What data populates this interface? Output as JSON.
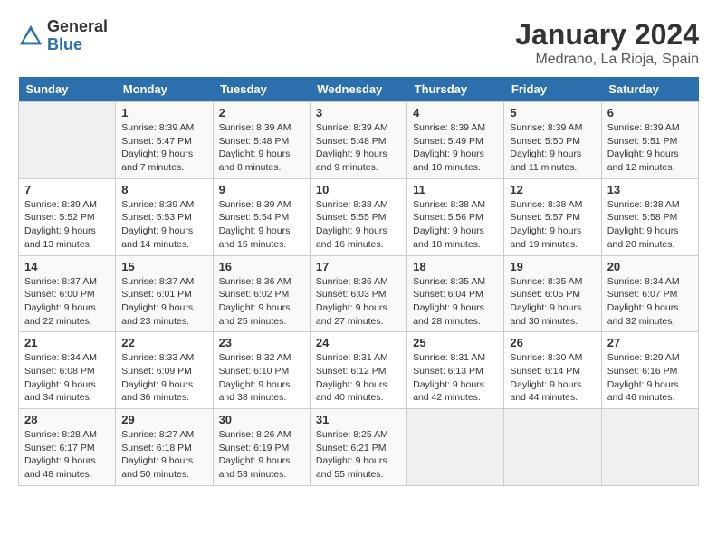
{
  "header": {
    "logo_general": "General",
    "logo_blue": "Blue",
    "month_year": "January 2024",
    "location": "Medrano, La Rioja, Spain"
  },
  "calendar": {
    "days_of_week": [
      "Sunday",
      "Monday",
      "Tuesday",
      "Wednesday",
      "Thursday",
      "Friday",
      "Saturday"
    ],
    "weeks": [
      [
        {
          "day": "",
          "info": ""
        },
        {
          "day": "1",
          "info": "Sunrise: 8:39 AM\nSunset: 5:47 PM\nDaylight: 9 hours\nand 7 minutes."
        },
        {
          "day": "2",
          "info": "Sunrise: 8:39 AM\nSunset: 5:48 PM\nDaylight: 9 hours\nand 8 minutes."
        },
        {
          "day": "3",
          "info": "Sunrise: 8:39 AM\nSunset: 5:48 PM\nDaylight: 9 hours\nand 9 minutes."
        },
        {
          "day": "4",
          "info": "Sunrise: 8:39 AM\nSunset: 5:49 PM\nDaylight: 9 hours\nand 10 minutes."
        },
        {
          "day": "5",
          "info": "Sunrise: 8:39 AM\nSunset: 5:50 PM\nDaylight: 9 hours\nand 11 minutes."
        },
        {
          "day": "6",
          "info": "Sunrise: 8:39 AM\nSunset: 5:51 PM\nDaylight: 9 hours\nand 12 minutes."
        }
      ],
      [
        {
          "day": "7",
          "info": "Sunrise: 8:39 AM\nSunset: 5:52 PM\nDaylight: 9 hours\nand 13 minutes."
        },
        {
          "day": "8",
          "info": "Sunrise: 8:39 AM\nSunset: 5:53 PM\nDaylight: 9 hours\nand 14 minutes."
        },
        {
          "day": "9",
          "info": "Sunrise: 8:39 AM\nSunset: 5:54 PM\nDaylight: 9 hours\nand 15 minutes."
        },
        {
          "day": "10",
          "info": "Sunrise: 8:38 AM\nSunset: 5:55 PM\nDaylight: 9 hours\nand 16 minutes."
        },
        {
          "day": "11",
          "info": "Sunrise: 8:38 AM\nSunset: 5:56 PM\nDaylight: 9 hours\nand 18 minutes."
        },
        {
          "day": "12",
          "info": "Sunrise: 8:38 AM\nSunset: 5:57 PM\nDaylight: 9 hours\nand 19 minutes."
        },
        {
          "day": "13",
          "info": "Sunrise: 8:38 AM\nSunset: 5:58 PM\nDaylight: 9 hours\nand 20 minutes."
        }
      ],
      [
        {
          "day": "14",
          "info": "Sunrise: 8:37 AM\nSunset: 6:00 PM\nDaylight: 9 hours\nand 22 minutes."
        },
        {
          "day": "15",
          "info": "Sunrise: 8:37 AM\nSunset: 6:01 PM\nDaylight: 9 hours\nand 23 minutes."
        },
        {
          "day": "16",
          "info": "Sunrise: 8:36 AM\nSunset: 6:02 PM\nDaylight: 9 hours\nand 25 minutes."
        },
        {
          "day": "17",
          "info": "Sunrise: 8:36 AM\nSunset: 6:03 PM\nDaylight: 9 hours\nand 27 minutes."
        },
        {
          "day": "18",
          "info": "Sunrise: 8:35 AM\nSunset: 6:04 PM\nDaylight: 9 hours\nand 28 minutes."
        },
        {
          "day": "19",
          "info": "Sunrise: 8:35 AM\nSunset: 6:05 PM\nDaylight: 9 hours\nand 30 minutes."
        },
        {
          "day": "20",
          "info": "Sunrise: 8:34 AM\nSunset: 6:07 PM\nDaylight: 9 hours\nand 32 minutes."
        }
      ],
      [
        {
          "day": "21",
          "info": "Sunrise: 8:34 AM\nSunset: 6:08 PM\nDaylight: 9 hours\nand 34 minutes."
        },
        {
          "day": "22",
          "info": "Sunrise: 8:33 AM\nSunset: 6:09 PM\nDaylight: 9 hours\nand 36 minutes."
        },
        {
          "day": "23",
          "info": "Sunrise: 8:32 AM\nSunset: 6:10 PM\nDaylight: 9 hours\nand 38 minutes."
        },
        {
          "day": "24",
          "info": "Sunrise: 8:31 AM\nSunset: 6:12 PM\nDaylight: 9 hours\nand 40 minutes."
        },
        {
          "day": "25",
          "info": "Sunrise: 8:31 AM\nSunset: 6:13 PM\nDaylight: 9 hours\nand 42 minutes."
        },
        {
          "day": "26",
          "info": "Sunrise: 8:30 AM\nSunset: 6:14 PM\nDaylight: 9 hours\nand 44 minutes."
        },
        {
          "day": "27",
          "info": "Sunrise: 8:29 AM\nSunset: 6:16 PM\nDaylight: 9 hours\nand 46 minutes."
        }
      ],
      [
        {
          "day": "28",
          "info": "Sunrise: 8:28 AM\nSunset: 6:17 PM\nDaylight: 9 hours\nand 48 minutes."
        },
        {
          "day": "29",
          "info": "Sunrise: 8:27 AM\nSunset: 6:18 PM\nDaylight: 9 hours\nand 50 minutes."
        },
        {
          "day": "30",
          "info": "Sunrise: 8:26 AM\nSunset: 6:19 PM\nDaylight: 9 hours\nand 53 minutes."
        },
        {
          "day": "31",
          "info": "Sunrise: 8:25 AM\nSunset: 6:21 PM\nDaylight: 9 hours\nand 55 minutes."
        },
        {
          "day": "",
          "info": ""
        },
        {
          "day": "",
          "info": ""
        },
        {
          "day": "",
          "info": ""
        }
      ]
    ]
  }
}
